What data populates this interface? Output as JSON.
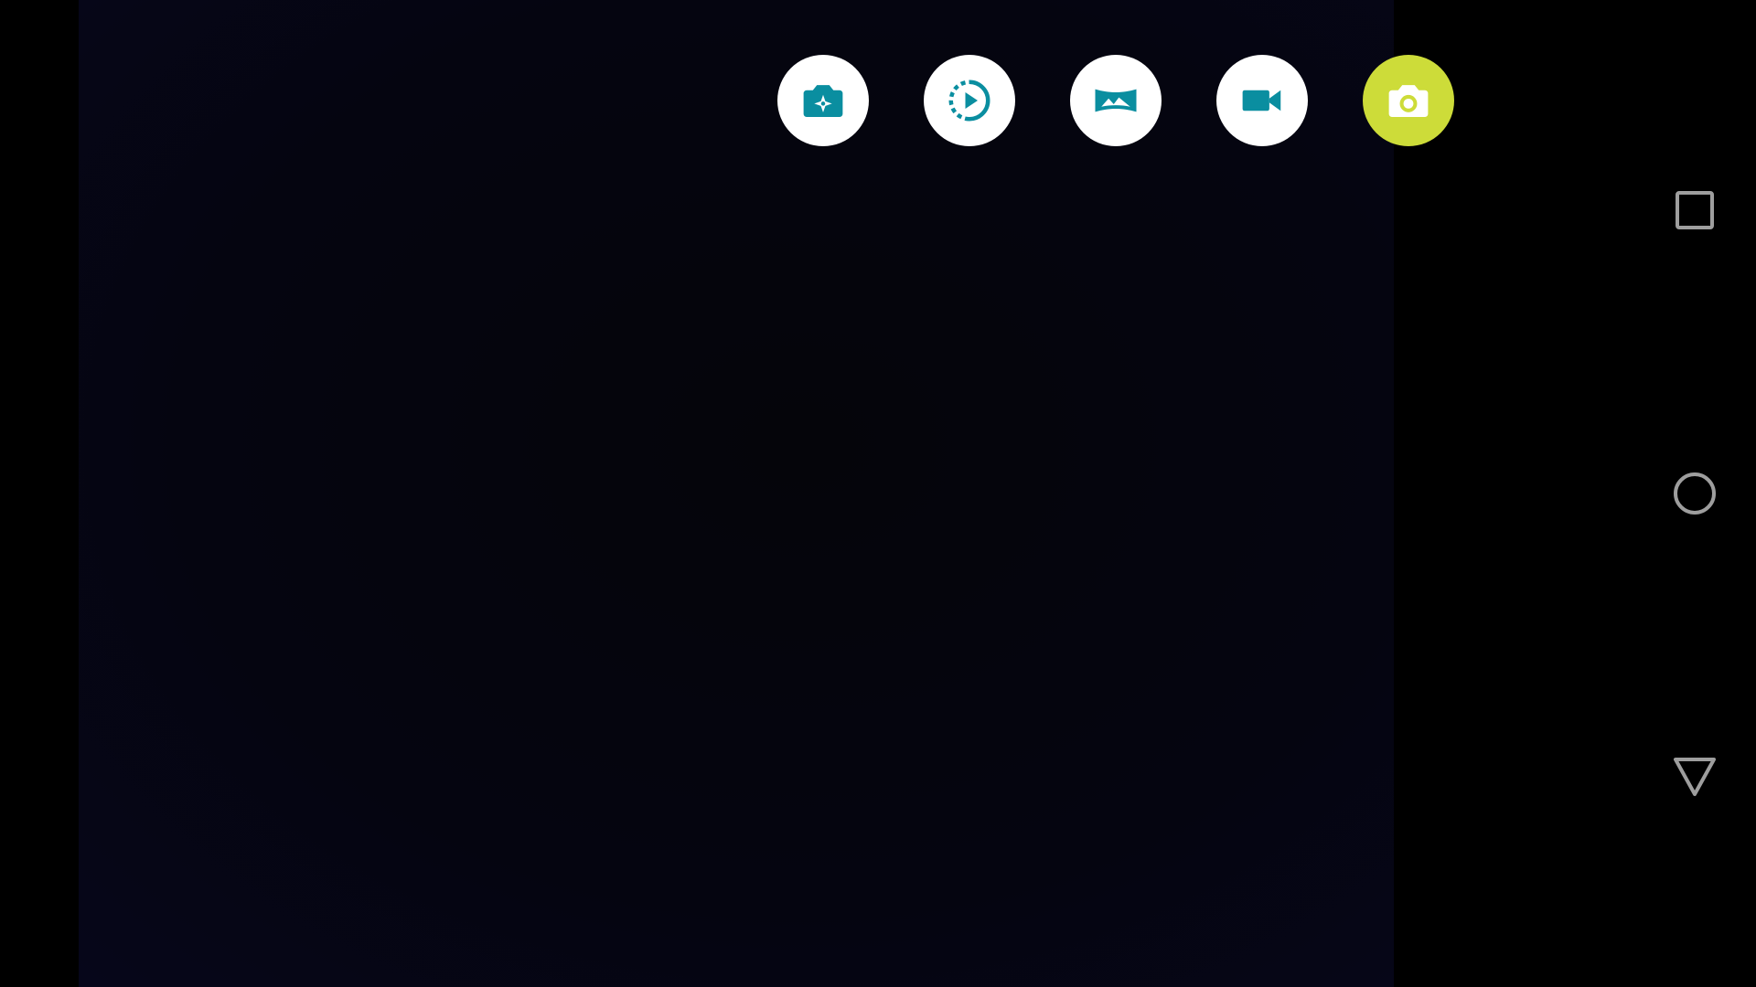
{
  "colors": {
    "background": "#000000",
    "viewfinder": "#050510",
    "mode_button_bg": "#ffffff",
    "mode_icon": "#0a8ea0",
    "active_mode_bg": "#cddc39",
    "active_mode_icon": "#ffffff",
    "nav_icon": "#9e9e9e"
  },
  "camera_modes": [
    {
      "icon": "photo-sphere-icon",
      "active": false
    },
    {
      "icon": "slow-motion-icon",
      "active": false
    },
    {
      "icon": "panorama-icon",
      "active": false
    },
    {
      "icon": "video-camera-icon",
      "active": false
    },
    {
      "icon": "camera-icon",
      "active": true
    }
  ],
  "navigation": {
    "recents_icon": "square-icon",
    "home_icon": "circle-icon",
    "back_icon": "triangle-icon"
  }
}
